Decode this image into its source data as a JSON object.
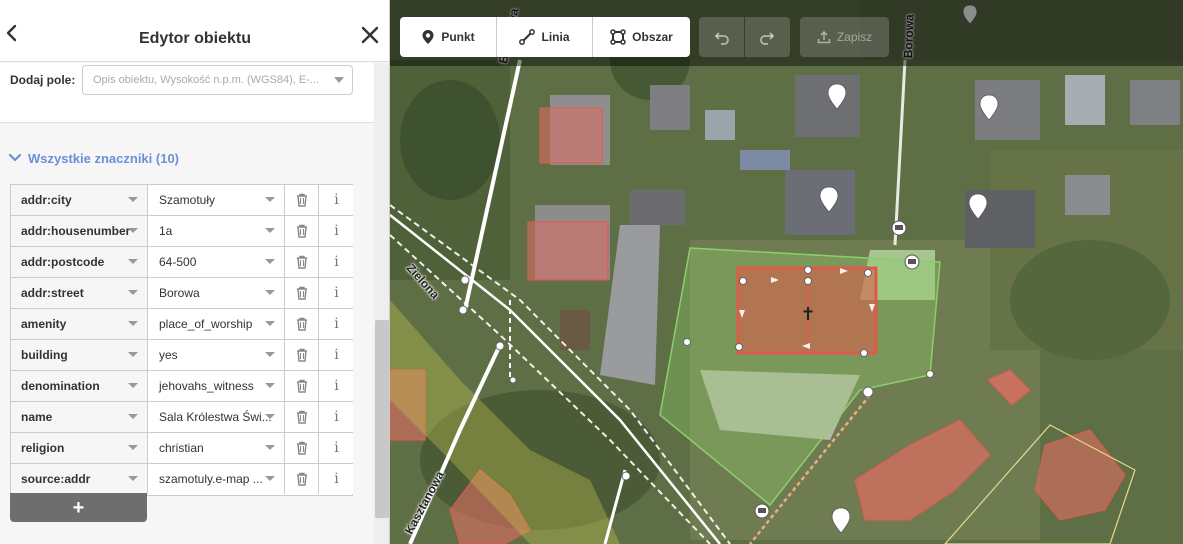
{
  "panel": {
    "title": "Edytor obiektu",
    "back_icon": "chevron-left-icon",
    "close_icon": "close-icon",
    "add_field": {
      "label": "Dodaj pole:",
      "placeholder": "Opis obiektu, Wysokość n.p.m. (WGS84), E-..."
    },
    "tags_section": {
      "title": "Wszystkie znaczniki (10)",
      "expanded": true
    },
    "tags": [
      {
        "key": "addr:city",
        "value": "Szamotuły"
      },
      {
        "key": "addr:housenumber",
        "value": "1a"
      },
      {
        "key": "addr:postcode",
        "value": "64-500"
      },
      {
        "key": "addr:street",
        "value": "Borowa"
      },
      {
        "key": "amenity",
        "value": "place_of_worship"
      },
      {
        "key": "building",
        "value": "yes"
      },
      {
        "key": "denomination",
        "value": "jehovahs_witness"
      },
      {
        "key": "name",
        "value": "Sala Królestwa Świ..."
      },
      {
        "key": "religion",
        "value": "christian"
      },
      {
        "key": "source:addr",
        "value": "szamotuly.e-map ..."
      }
    ],
    "info_glyph": "i",
    "add_tag_label": "+"
  },
  "toolbar": {
    "modes": [
      {
        "label": "Punkt",
        "icon": "map-pin-icon"
      },
      {
        "label": "Linia",
        "icon": "line-icon"
      },
      {
        "label": "Obszar",
        "icon": "area-icon"
      }
    ],
    "undo_icon": "undo-icon",
    "redo_icon": "redo-icon",
    "save_label": "Zapisz",
    "save_enabled": false
  },
  "map": {
    "street_labels": [
      "Brzozowa",
      "Borowa",
      "Zielona",
      "Kasztanowa"
    ],
    "selected_feature": "place-of-worship",
    "colors": {
      "selected_building": "#e05a4a",
      "landuse_area": "#8ccf6a",
      "road": "#ffffff",
      "accent": "#6b8fd8"
    }
  }
}
